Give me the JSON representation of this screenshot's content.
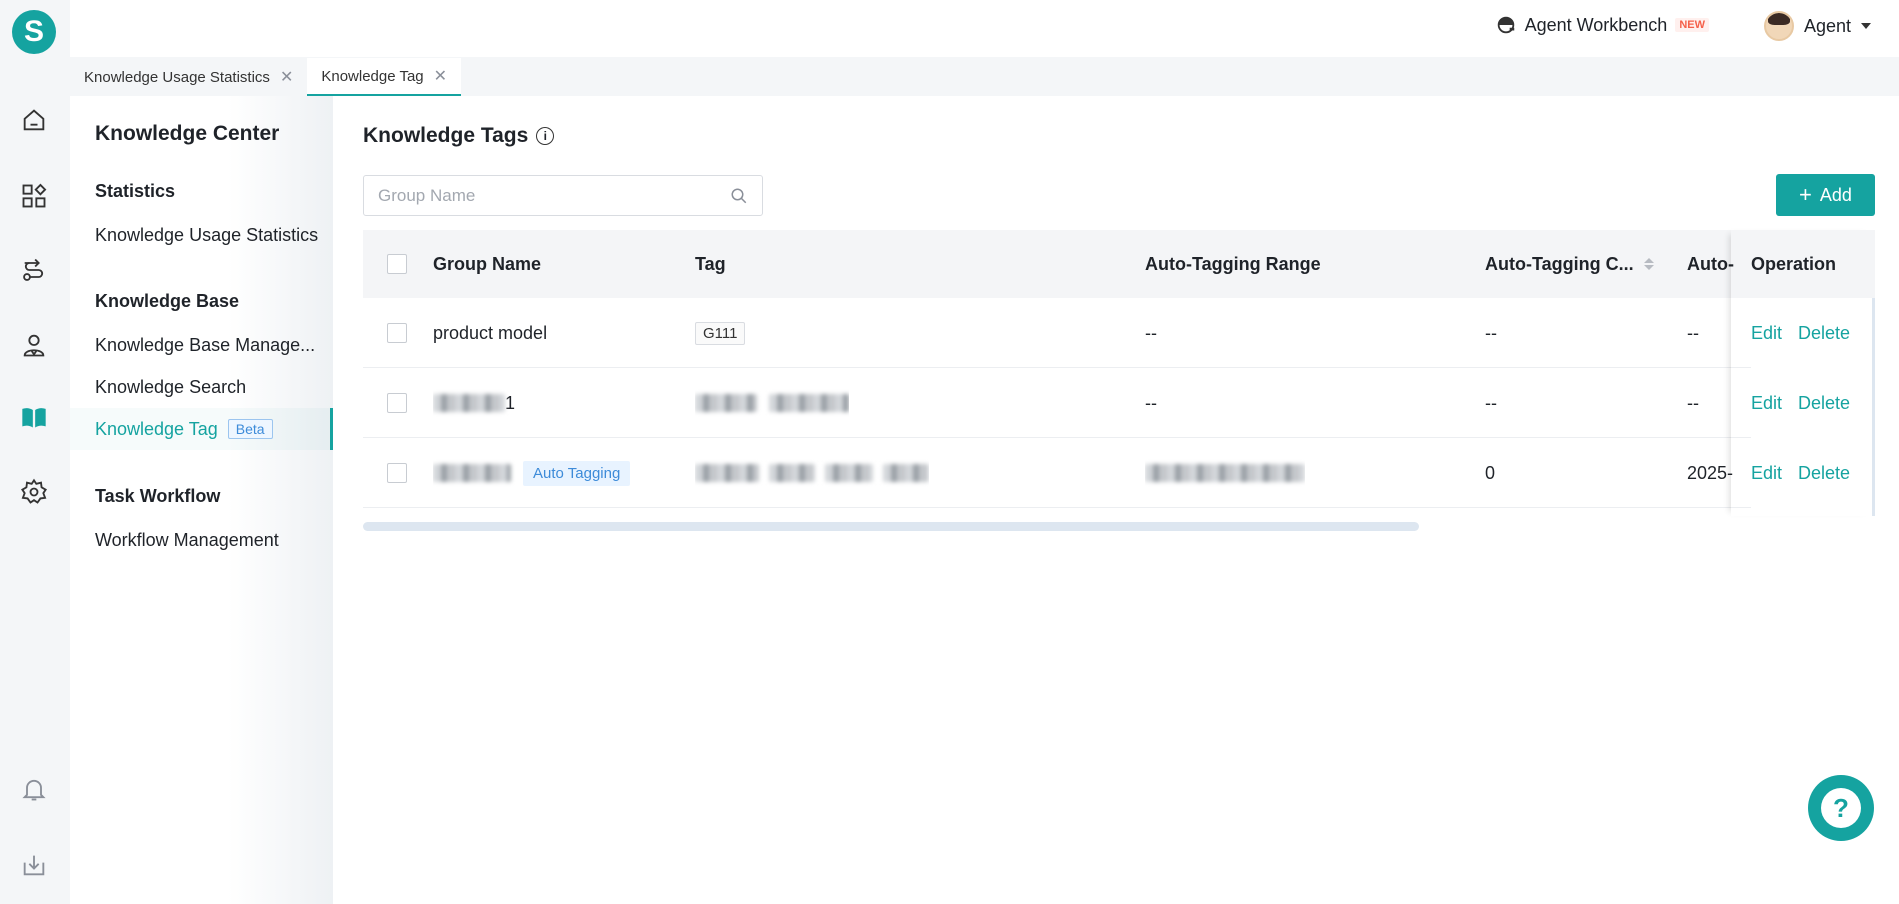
{
  "app": {
    "logo_letter": "S",
    "accent": "#15a3a0"
  },
  "topbar": {
    "workbench_label": "Agent Workbench",
    "workbench_badge": "NEW",
    "user_name": "Agent"
  },
  "tabs": [
    {
      "label": "Knowledge Usage Statistics",
      "close": "✕"
    },
    {
      "label": "Knowledge Tag",
      "close": "✕"
    }
  ],
  "sidebar": {
    "title": "Knowledge Center",
    "groups": [
      {
        "title": "Statistics",
        "items": [
          "Knowledge Usage Statistics"
        ]
      },
      {
        "title": "Knowledge Base",
        "items": [
          "Knowledge Base Manage...",
          "Knowledge Search",
          "Knowledge Tag"
        ]
      },
      {
        "title": "Task Workflow",
        "items": [
          "Workflow Management"
        ]
      }
    ],
    "active_badge": "Beta"
  },
  "rail_icons": [
    "home-icon",
    "apps-icon",
    "route-icon",
    "user-service-icon",
    "book-icon",
    "settings-icon",
    "bell-icon",
    "download-icon"
  ],
  "main": {
    "title": "Knowledge Tags",
    "search_placeholder": "Group Name",
    "add_label": "Add"
  },
  "table": {
    "columns": [
      "Group Name",
      "Tag",
      "Auto-Tagging Range",
      "Auto-Tagging C...",
      "Auto-",
      "Operation"
    ],
    "rows": [
      {
        "group": "product model",
        "tags": [
          "G111"
        ],
        "range": "--",
        "count": "--",
        "auto": "--"
      },
      {
        "group": "1",
        "tags": [],
        "range": "--",
        "count": "--",
        "auto": "--"
      },
      {
        "group": "",
        "badge": "Auto Tagging",
        "tags": [],
        "range": "",
        "count": "0",
        "auto": "2025-"
      }
    ],
    "edit_label": "Edit",
    "delete_label": "Delete"
  },
  "help": {
    "label": "?"
  }
}
